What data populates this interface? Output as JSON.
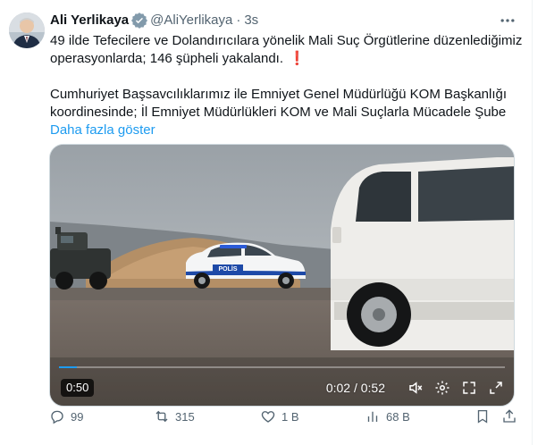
{
  "author": {
    "name": "Ali Yerlikaya",
    "handle": "@AliYerlikaya",
    "separator": "·",
    "time": "3s",
    "verified_icon": "verified-badge-icon"
  },
  "tweet": {
    "line1": "49 ilde Tefecilere ve Dolandırıcılara yönelik Mali Suç Örgütlerine düzenlediğimiz",
    "line2": "operasyonlarda; 146 şüpheli yakalandı.",
    "line2_emoji": "❗",
    "line3": "Cumhuriyet Başsavcılıklarımız ile Emniyet Genel Müdürlüğü KOM Başkanlığı",
    "line4": "koordinesinde; İl Emniyet Müdürlükleri KOM ve Mali Suçlarla Mücadele Şube",
    "show_more": "Daha fazla göster"
  },
  "video": {
    "duration_badge": "0:50",
    "timer": "0:02 / 0:52",
    "progress": 0.04,
    "police_label": "POLİS",
    "icons": [
      "mute-icon",
      "settings-icon",
      "fullscreen-icon",
      "expand-icon"
    ]
  },
  "actions": {
    "replies": "99",
    "reposts": "315",
    "likes": "1 B",
    "views": "68 B"
  },
  "colors": {
    "accent": "#1d9bf0",
    "text": "#0f1419",
    "muted": "#536471",
    "alert": "#d8262b"
  }
}
